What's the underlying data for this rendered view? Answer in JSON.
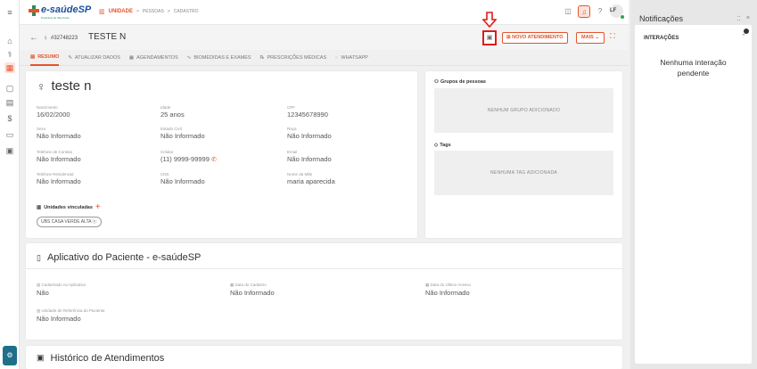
{
  "app": {
    "brand": "e-saúdeSP",
    "brand_tagline": "Prefeitura de São Paulo"
  },
  "breadcrumb": {
    "unit": "UNIDADE",
    "sep1": ">",
    "level2": "PESSOAS",
    "sep2": ">",
    "level3": "CADASTRO"
  },
  "user": {
    "initials": "LF"
  },
  "patient_header": {
    "id": "#32748223",
    "name": "TESTE N"
  },
  "actions": {
    "novo_atendimento": "NOVO ATENDIMENTO",
    "mais": "MAIS ⌄"
  },
  "tabs": [
    {
      "label": "RESUMO",
      "icon": "summary-icon"
    },
    {
      "label": "ATUALIZAR DADOS",
      "icon": "edit-icon"
    },
    {
      "label": "AGENDAMENTOS",
      "icon": "calendar-icon"
    },
    {
      "label": "BIOMEDIDAS E EXAMES",
      "icon": "pulse-icon"
    },
    {
      "label": "PRESCRIÇÕES MÉDICAS",
      "icon": "prescription-icon"
    },
    {
      "label": "WHATSAPP",
      "icon": "whatsapp-icon"
    }
  ],
  "summary": {
    "name": "teste n",
    "fields": [
      {
        "label": "Nascimento",
        "value": "16/02/2000"
      },
      {
        "label": "Idade",
        "value": "25 anos"
      },
      {
        "label": "CPF",
        "value": "12345678990"
      },
      {
        "label": "Sexo",
        "value": "Não Informado"
      },
      {
        "label": "Estado Civil",
        "value": "Não Informado"
      },
      {
        "label": "Raça",
        "value": "Não Informado"
      },
      {
        "label": "Telefone de Contato",
        "value": "Não Informado"
      },
      {
        "label": "Celular",
        "value": "(11) 9999-99999"
      },
      {
        "label": "Email",
        "value": "Não Informado"
      },
      {
        "label": "Telefone Residencial",
        "value": "Não Informado"
      },
      {
        "label": "CNS",
        "value": "Não Informado"
      },
      {
        "label": "Nome da Mãe",
        "value": "maria aparecida"
      }
    ],
    "units_title": "Unidades vinculadas",
    "unit_chip": "UBS CASA VERDE ALTA ⓧ"
  },
  "side": {
    "groups_title": "Grupos de pessoas",
    "groups_empty": "NENHUM GRUPO ADICIONADO",
    "tags_title": "Tags",
    "tags_empty": "NENHUMA TAG ADICIONADA"
  },
  "app_card": {
    "title": "Aplicativo do Paciente - e-saúdeSP",
    "fields": [
      {
        "label": "Cadastrado no Aplicativo",
        "value": "Não"
      },
      {
        "label": "Data do Cadastro",
        "value": "Não Informado"
      },
      {
        "label": "Data do Último Acesso",
        "value": "Não Informado"
      },
      {
        "label": "Unidade de Referência do Paciente",
        "value": "Não Informado"
      }
    ]
  },
  "history": {
    "title": "Histórico de Atendimentos"
  },
  "notifications": {
    "title": "Notificações",
    "section": "INTERAÇÕES",
    "empty": "Nenhuma interação pendente"
  },
  "colors": {
    "accent": "#e5532d",
    "brand_blue": "#1b4f9c",
    "highlight_red": "#e01b1b"
  }
}
